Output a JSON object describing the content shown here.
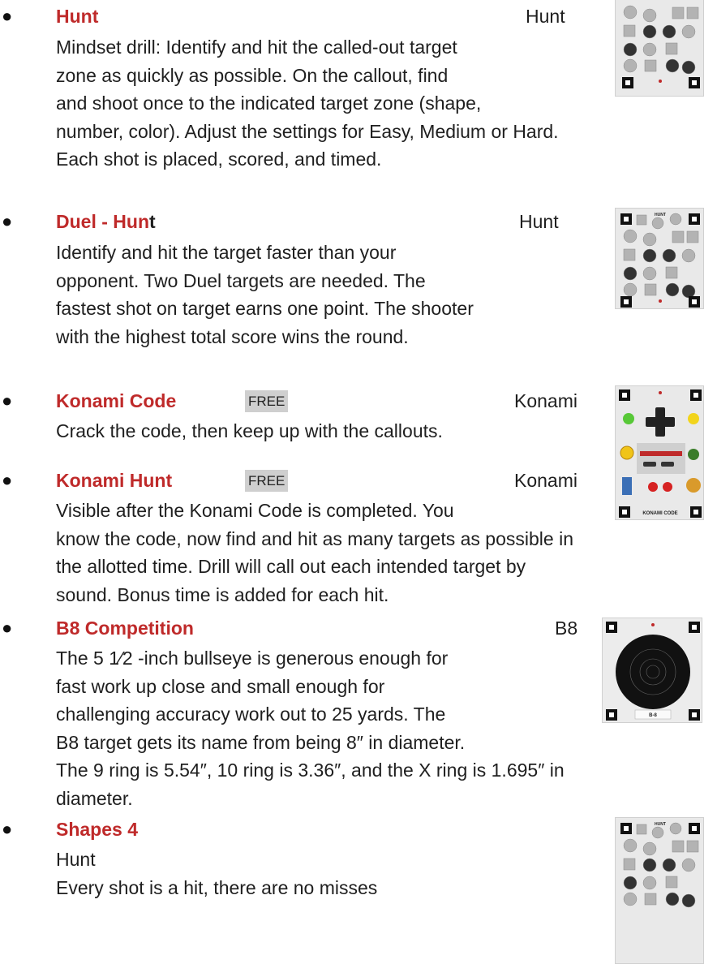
{
  "entries": [
    {
      "title": "Hunt",
      "badge": "",
      "category": "Hunt",
      "lines": [
        "Mindset drill: Identify and hit the called-out target",
        "zone as quickly as possible. On the callout, find",
        "and shoot once to the indicated target zone (shape,",
        "number, color). Adjust the settings for Easy, Medium or Hard.",
        "Each shot is placed, scored, and timed."
      ]
    },
    {
      "title": "Duel - Hun",
      "title_tail": "t",
      "badge": "",
      "category": "Hunt",
      "lines": [
        "Identify and hit the target faster than your",
        "opponent. Two Duel targets are needed. The",
        "fastest shot on target earns one point. The shooter",
        "with the highest total score wins the round."
      ]
    },
    {
      "title": "Konami Code",
      "badge": "FREE",
      "category": "Konami",
      "lines": [
        "Crack the code, then keep up with the callouts."
      ]
    },
    {
      "title": "Konami Hunt",
      "badge": "FREE",
      "category": "Konami",
      "lines": [
        "Visible after the Konami Code is completed. You",
        "know the code, now find and hit as many targets as possible in",
        "the allotted time. Drill will call out each intended target by",
        "sound. Bonus time is added for each hit."
      ]
    },
    {
      "title": "B8 Competition",
      "badge": "",
      "category": "B8",
      "lines": [
        "The 5 1⁄2 -inch bullseye is generous enough for",
        "fast work up close and small enough for",
        "challenging accuracy work out to 25 yards. The",
        "B8 target gets its name from being 8″ in diameter.",
        "The 9 ring is 5.54″, 10 ring is 3.36″, and the X ring is 1.695″ in",
        "diameter."
      ]
    },
    {
      "title": "Shapes 4",
      "badge": "",
      "category": "",
      "lines": [
        "Hunt",
        "Every shot is a hit, there are no misses"
      ]
    }
  ],
  "thumbnails": {
    "hunt_caption": "HUNT",
    "konami_caption": "KONAMI CODE",
    "b8_caption": "B-8",
    "colors": {
      "accent": "#bf2a2a",
      "thumb_bg": "#e9e9e9",
      "hex_gray": "#b3b3b3",
      "hex_dark": "#333333"
    }
  }
}
